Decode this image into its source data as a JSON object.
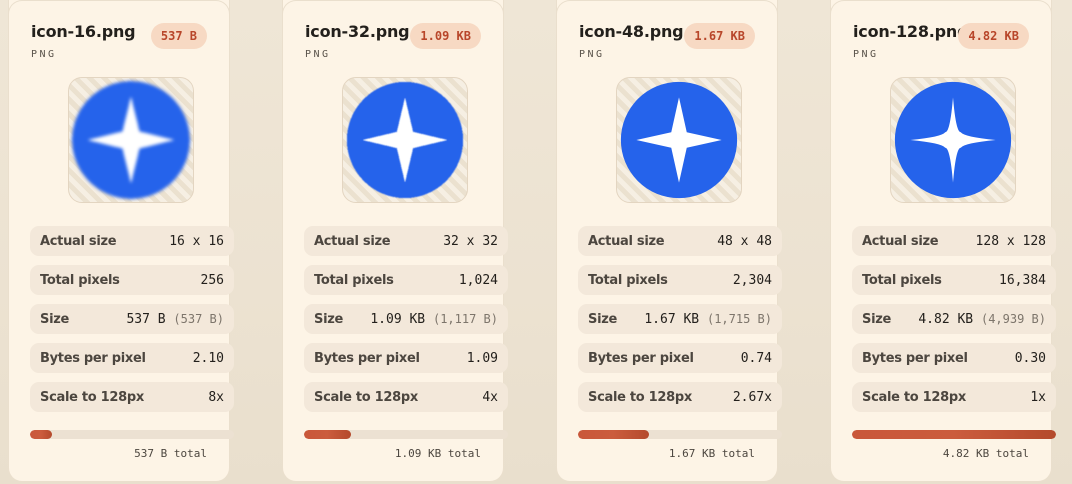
{
  "colors": {
    "accent": "#b8462a",
    "icon_blue": "#2563eb",
    "card_bg": "#fdf4e6"
  },
  "labels": {
    "actual_size": "Actual size",
    "total_pixels": "Total pixels",
    "size": "Size",
    "bytes_per_pixel": "Bytes per pixel",
    "scale": "Scale to 128px"
  },
  "cards": [
    {
      "filename": "icon-16.png",
      "format": "PNG",
      "badge": "537 B",
      "preview_icon": "compass-star-icon",
      "actual_size": "16 x 16",
      "total_pixels": "256",
      "size_main": "537 B",
      "size_sub": "(537 B)",
      "bytes_per_pixel": "2.10",
      "scale": "8x",
      "progress": 0.11,
      "total": "537 B total"
    },
    {
      "filename": "icon-32.png",
      "format": "PNG",
      "badge": "1.09 KB",
      "preview_icon": "compass-star-icon",
      "actual_size": "32 x 32",
      "total_pixels": "1,024",
      "size_main": "1.09 KB",
      "size_sub": "(1,117 B)",
      "bytes_per_pixel": "1.09",
      "scale": "4x",
      "progress": 0.23,
      "total": "1.09 KB total"
    },
    {
      "filename": "icon-48.png",
      "format": "PNG",
      "badge": "1.67 KB",
      "preview_icon": "compass-star-icon",
      "actual_size": "48 x 48",
      "total_pixels": "2,304",
      "size_main": "1.67 KB",
      "size_sub": "(1,715 B)",
      "bytes_per_pixel": "0.74",
      "scale": "2.67x",
      "progress": 0.35,
      "total": "1.67 KB total"
    },
    {
      "filename": "icon-128.png",
      "format": "PNG",
      "badge": "4.82 KB",
      "preview_icon": "compass-star-icon",
      "actual_size": "128 x 128",
      "total_pixels": "16,384",
      "size_main": "4.82 KB",
      "size_sub": "(4,939 B)",
      "bytes_per_pixel": "0.30",
      "scale": "1x",
      "progress": 1.0,
      "total": "4.82 KB total"
    }
  ]
}
